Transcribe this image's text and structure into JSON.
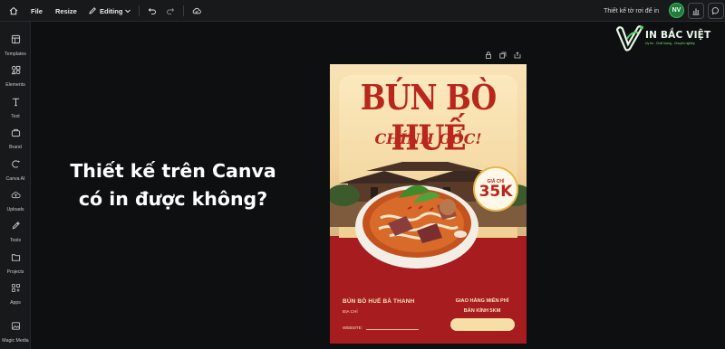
{
  "topbar": {
    "file_label": "File",
    "resize_label": "Resize",
    "editing_label": "Editing",
    "design_title": "Thiết kế tờ rơi để in",
    "avatar_initials": "NV"
  },
  "sidebar": {
    "items": [
      {
        "label": "Templates",
        "icon": "templates-icon"
      },
      {
        "label": "Elements",
        "icon": "elements-icon"
      },
      {
        "label": "Text",
        "icon": "text-icon"
      },
      {
        "label": "Brand",
        "icon": "brand-icon"
      },
      {
        "label": "Canva AI",
        "icon": "canva-ai-icon"
      },
      {
        "label": "Uploads",
        "icon": "uploads-icon"
      },
      {
        "label": "Tools",
        "icon": "tools-icon"
      },
      {
        "label": "Projects",
        "icon": "projects-icon"
      },
      {
        "label": "Apps",
        "icon": "apps-icon"
      },
      {
        "label": "Magic Media",
        "icon": "magic-media-icon"
      }
    ]
  },
  "overlay": {
    "headline_line1": "Thiết kế trên Canva",
    "headline_line2": "có in được không?",
    "logo_text": "IN BẮC VIỆT",
    "logo_subtext": "Uy tín - Chất lượng - Chuyên nghiệp"
  },
  "poster": {
    "title_line1": "BÚN BÒ HUẾ",
    "title_line2": "CHÍNH GỐC!",
    "price_label": "GIÁ CHỈ",
    "price_value": "35K",
    "shop_name": "BÚN BÒ HUẾ BÀ THANH",
    "address_label": "ĐỊA CHỈ",
    "website_label": "WEBSITE:",
    "delivery_line1": "GIAO HÀNG MIỄN PHÍ",
    "delivery_line2": "BÁN KÍNH 5KM"
  },
  "colors": {
    "accent_green": "#1e7d3a",
    "poster_red": "#a71d1f",
    "poster_cream": "#f8e3b6"
  }
}
